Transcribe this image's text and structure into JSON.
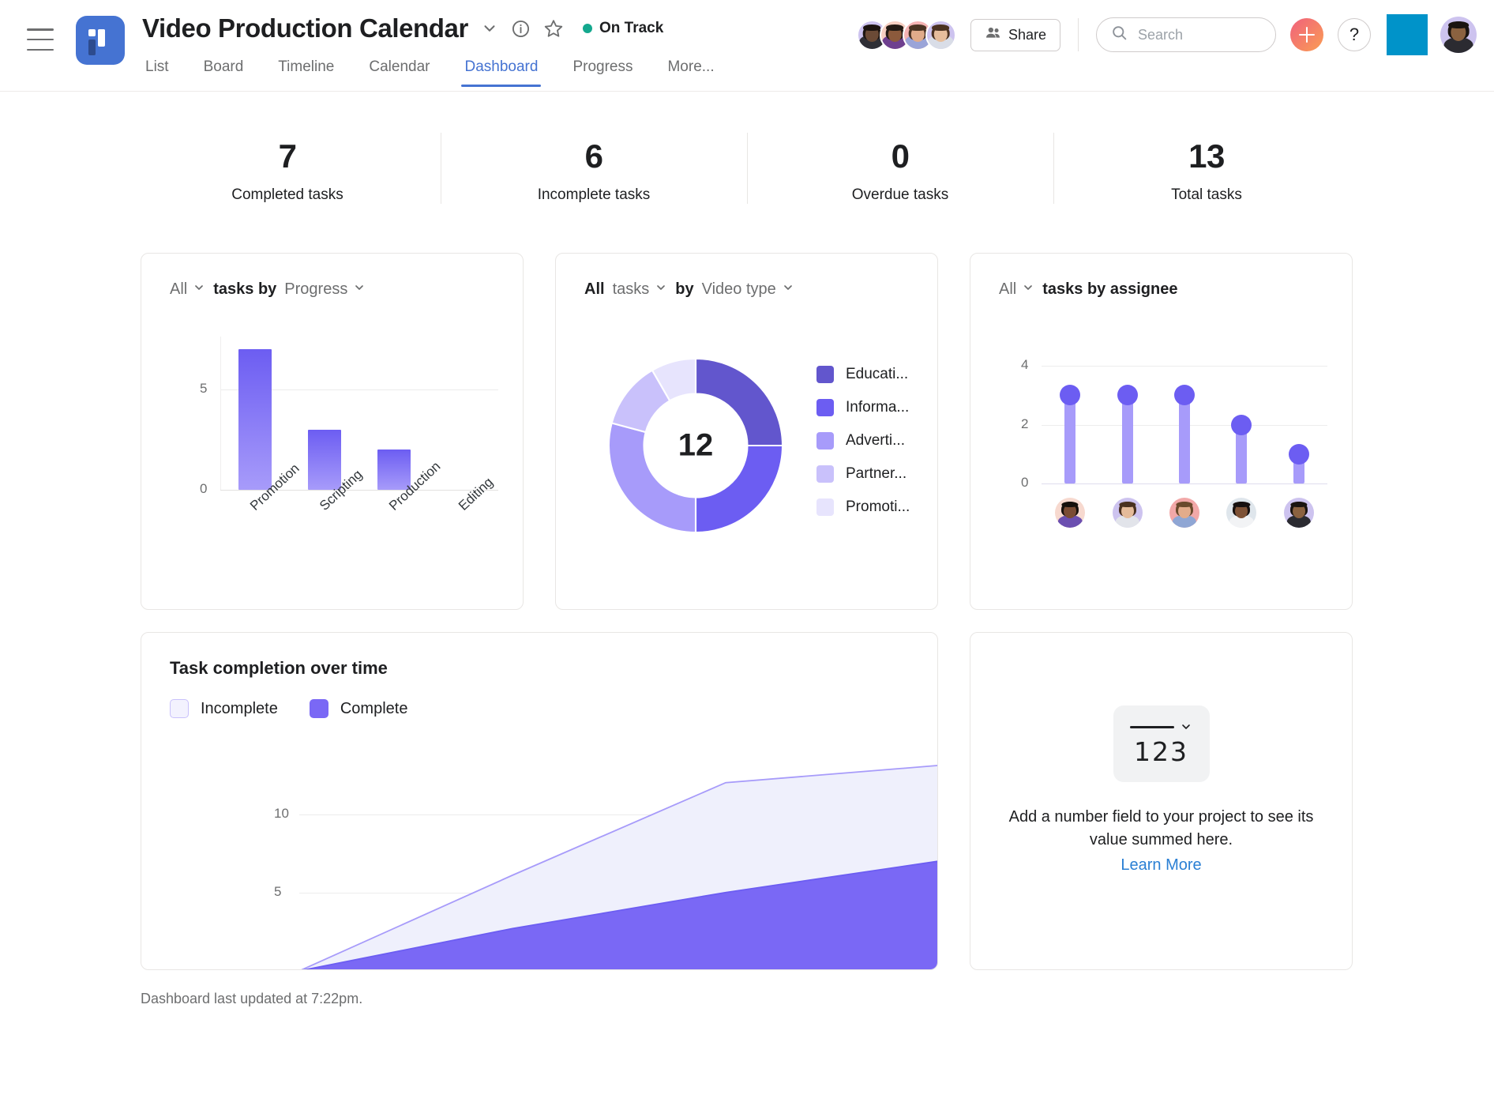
{
  "header": {
    "menu_icon": "hamburger-icon",
    "project_icon": "project-board-icon",
    "title": "Video Production Calendar",
    "caret_icon": "chevron-down-icon",
    "info_icon": "info-circle-icon",
    "star_icon": "star-outline-icon",
    "status": "On Track",
    "status_color": "#14a88e",
    "tabs": [
      {
        "label": "List",
        "active": false
      },
      {
        "label": "Board",
        "active": false
      },
      {
        "label": "Timeline",
        "active": false
      },
      {
        "label": "Calendar",
        "active": false
      },
      {
        "label": "Dashboard",
        "active": true
      },
      {
        "label": "Progress",
        "active": false
      },
      {
        "label": "More...",
        "active": false
      }
    ],
    "share_label": "Share",
    "share_icon": "people-icon",
    "search_placeholder": "Search",
    "search_icon": "search-icon",
    "add_icon": "plus-icon",
    "help_icon": "question-mark-icon",
    "accent_blue": "#4573d2",
    "member_avatars": [
      {
        "bg": "#cdc3ef",
        "skin": "#6b4a36",
        "hair": "#1c1410",
        "shirt": "#2f2f36"
      },
      {
        "bg": "#f6cfc2",
        "skin": "#8c5a3c",
        "hair": "#231a14",
        "shirt": "#6e3f8f"
      },
      {
        "bg": "#f5b3b3",
        "skin": "#e0ab8a",
        "hair": "#4a3322",
        "shirt": "#9aa4d8"
      },
      {
        "bg": "#cdc3ef",
        "skin": "#e6bd9c",
        "hair": "#4b3222",
        "shirt": "#d9dde7"
      }
    ],
    "me_avatar": {
      "bg": "#cdc3ef",
      "skin": "#8b6240",
      "hair": "#1a1410",
      "shirt": "#2b2b31"
    }
  },
  "stats": [
    {
      "value": "7",
      "label": "Completed tasks"
    },
    {
      "value": "6",
      "label": "Incomplete tasks"
    },
    {
      "value": "0",
      "label": "Overdue tasks"
    },
    {
      "value": "13",
      "label": "Total tasks"
    }
  ],
  "cards": {
    "bar": {
      "filter": "All",
      "mid_label": "tasks by",
      "group_by": "Progress"
    },
    "donut": {
      "filter": "All",
      "unit": "tasks",
      "by": "by",
      "group_by": "Video type",
      "center_value": "12"
    },
    "assignee": {
      "filter": "All",
      "title": "tasks by assignee"
    },
    "area": {
      "title": "Task completion over time",
      "legend": [
        "Incomplete",
        "Complete"
      ]
    },
    "number": {
      "icon_digits": "123",
      "message": "Add a number field to your project to see its value summed here.",
      "link": "Learn More",
      "link_color": "#2a7fd4"
    }
  },
  "footer": "Dashboard last updated at 7:22pm.",
  "chart_data": [
    {
      "type": "bar",
      "title": "All tasks by Progress",
      "categories": [
        "Promotion",
        "Scripting",
        "Production",
        "Editing"
      ],
      "values": [
        7,
        3,
        2,
        0
      ],
      "xlabel": "",
      "ylabel": "",
      "ylim": [
        0,
        7.6
      ],
      "yticks": [
        0,
        5
      ],
      "grid": true,
      "bar_color_top": "#6c5df2",
      "bar_color_bottom": "#a79bfa"
    },
    {
      "type": "pie",
      "title": "All tasks by Video type",
      "center_total": 12,
      "labels": [
        "Educati...",
        "Informa...",
        "Adverti...",
        "Partner...",
        "Promoti..."
      ],
      "full_labels": [
        "Educational",
        "Informational",
        "Advertising",
        "Partnership",
        "Promotional"
      ],
      "values": [
        3,
        3,
        3.5,
        1.5,
        1
      ],
      "colors": [
        "#6256cd",
        "#6c5df2",
        "#a79bfa",
        "#c9c1fb",
        "#e7e4fd"
      ],
      "legend_position": "right",
      "donut": true
    },
    {
      "type": "bar",
      "subtype": "lollipop",
      "title": "All tasks by assignee",
      "categories": [
        "assignee-1",
        "assignee-2",
        "assignee-3",
        "assignee-4",
        "assignee-5"
      ],
      "values": [
        3,
        3,
        3,
        2,
        1
      ],
      "ylim": [
        0,
        4.6
      ],
      "yticks": [
        0,
        2,
        4
      ],
      "grid": true,
      "stem_color": "#a79bfa",
      "dot_color": "#6c5df2",
      "avatars": [
        {
          "bg": "#f7d9cf",
          "skin": "#7a4c34",
          "hair": "#16100c",
          "shirt": "#6b4fb0"
        },
        {
          "bg": "#cdc3ef",
          "skin": "#e5bb9a",
          "hair": "#4a3120",
          "shirt": "#e2e4ea"
        },
        {
          "bg": "#f2a8a8",
          "skin": "#e3ac8b",
          "hair": "#6a4a2c",
          "shirt": "#8fa6d4"
        },
        {
          "bg": "#dfe6ec",
          "skin": "#7e5236",
          "hair": "#171110",
          "shirt": "#f2f3f5"
        },
        {
          "bg": "#cdc3ef",
          "skin": "#8b6240",
          "hair": "#1a1410",
          "shirt": "#2b2b31"
        }
      ]
    },
    {
      "type": "area",
      "title": "Task completion over time",
      "series": [
        {
          "name": "Incomplete",
          "values": [
            0,
            6.1,
            12.0,
            13.1
          ],
          "color": "#eff0fc",
          "line_color": "#a79bfa"
        },
        {
          "name": "Complete",
          "values": [
            0,
            2.7,
            5.0,
            7.0
          ],
          "color": "#7a68f5",
          "line_color": "#6c5df2"
        }
      ],
      "x": [
        0,
        1,
        2,
        3
      ],
      "yticks": [
        5,
        10
      ],
      "ylim": [
        0,
        14
      ],
      "grid": true,
      "legend_position": "top-left"
    }
  ]
}
